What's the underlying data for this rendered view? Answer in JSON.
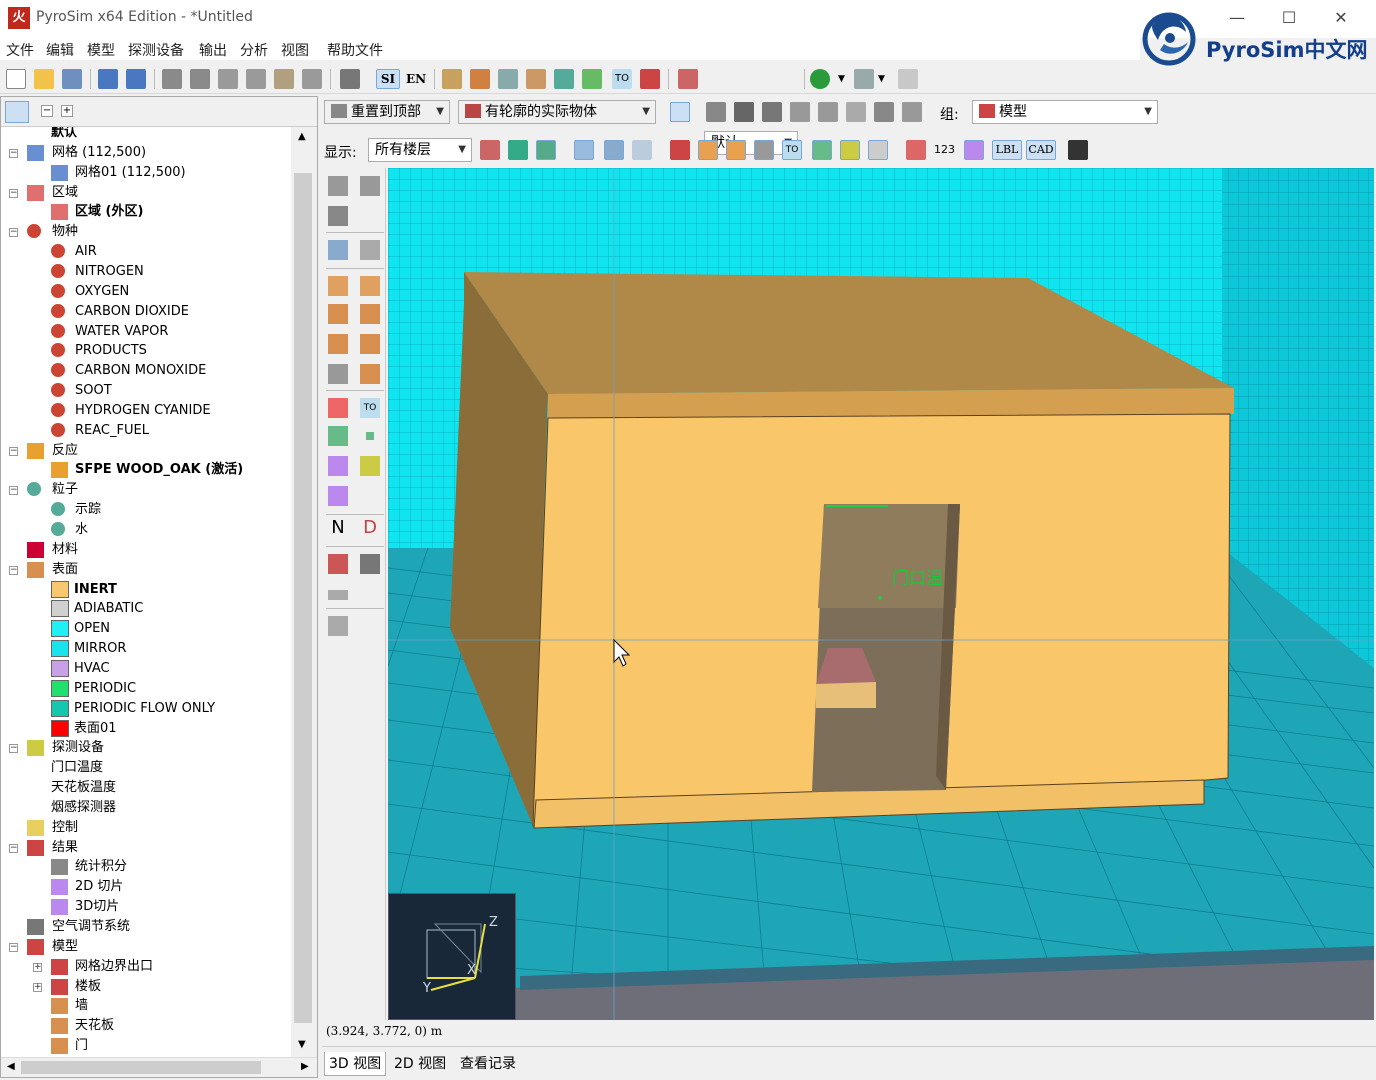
{
  "window": {
    "title": "PyroSim x64 Edition - *Untitled",
    "app_icon": "火",
    "minimize": "—",
    "maximize": "☐",
    "close": "✕"
  },
  "logo": {
    "text": "PyroSim中文网"
  },
  "menu": [
    "文件",
    "编辑",
    "模型",
    "探测设备",
    "输出",
    "分析",
    "视图",
    "帮助文件"
  ],
  "toolbar": {
    "si": "SI",
    "en": "EN",
    "to": "TO",
    "profile": "默认"
  },
  "view_toolbar": {
    "reset": "重置到顶部",
    "render_mode": "有轮廓的实际物体",
    "group_label": "组:",
    "group_value": "模型"
  },
  "view_toolbar2": {
    "show_label": "显示:",
    "floors": "所有楼层",
    "to": "TO",
    "lbl": "LBL",
    "cad": "CAD",
    "num": "123"
  },
  "side_tools": {
    "n": "N",
    "d": "D",
    "to": "TO"
  },
  "tree": [
    {
      "label": "默认",
      "bold": true
    },
    {
      "label": "网格 (112,500)"
    },
    {
      "label": "网格01 (112,500)"
    },
    {
      "label": "区域"
    },
    {
      "label": "区域 (外区)",
      "bold": true
    },
    {
      "label": "物种"
    },
    {
      "label": "AIR"
    },
    {
      "label": "NITROGEN"
    },
    {
      "label": "OXYGEN"
    },
    {
      "label": "CARBON DIOXIDE"
    },
    {
      "label": "WATER VAPOR"
    },
    {
      "label": "PRODUCTS"
    },
    {
      "label": "CARBON MONOXIDE"
    },
    {
      "label": "SOOT"
    },
    {
      "label": "HYDROGEN CYANIDE"
    },
    {
      "label": "REAC_FUEL"
    },
    {
      "label": "反应"
    },
    {
      "label": "SFPE WOOD_OAK (激活)",
      "bold": true
    },
    {
      "label": "粒子"
    },
    {
      "label": "示踪"
    },
    {
      "label": "水"
    },
    {
      "label": "材料"
    },
    {
      "label": "表面"
    },
    {
      "label": "INERT",
      "bold": true,
      "color": "#f7c870"
    },
    {
      "label": "ADIABATIC",
      "color": "#d0d0d0"
    },
    {
      "label": "OPEN",
      "color": "#1ff0f4"
    },
    {
      "label": "MIRROR",
      "color": "#18e4ec"
    },
    {
      "label": "HVAC",
      "color": "#c8a0e8"
    },
    {
      "label": "PERIODIC",
      "color": "#20e070"
    },
    {
      "label": "PERIODIC FLOW ONLY",
      "color": "#14c8b0"
    },
    {
      "label": "表面01",
      "color": "#ff0000"
    },
    {
      "label": "探测设备"
    },
    {
      "label": "门口温度"
    },
    {
      "label": "天花板温度"
    },
    {
      "label": "烟感探测器"
    },
    {
      "label": "控制"
    },
    {
      "label": "结果"
    },
    {
      "label": "统计积分"
    },
    {
      "label": "2D 切片"
    },
    {
      "label": "3D切片"
    },
    {
      "label": "空气调节系统"
    },
    {
      "label": "模型"
    },
    {
      "label": "网格边界出口"
    },
    {
      "label": "楼板"
    },
    {
      "label": "墙"
    },
    {
      "label": "天花板"
    },
    {
      "label": "门"
    }
  ],
  "viewport": {
    "door_label": "门口温",
    "axis_z": "Z",
    "axis_x": "X",
    "axis_y": "Y"
  },
  "status": {
    "coords": "(3.924, 3.772, 0) m"
  },
  "tabs": [
    "3D 视图",
    "2D 视图",
    "查看记录"
  ],
  "colors": {
    "wall": "#f9c66a",
    "roof": "#d8a44a",
    "floor": "#1a9ab0",
    "wall_grid": "#10dcea"
  }
}
